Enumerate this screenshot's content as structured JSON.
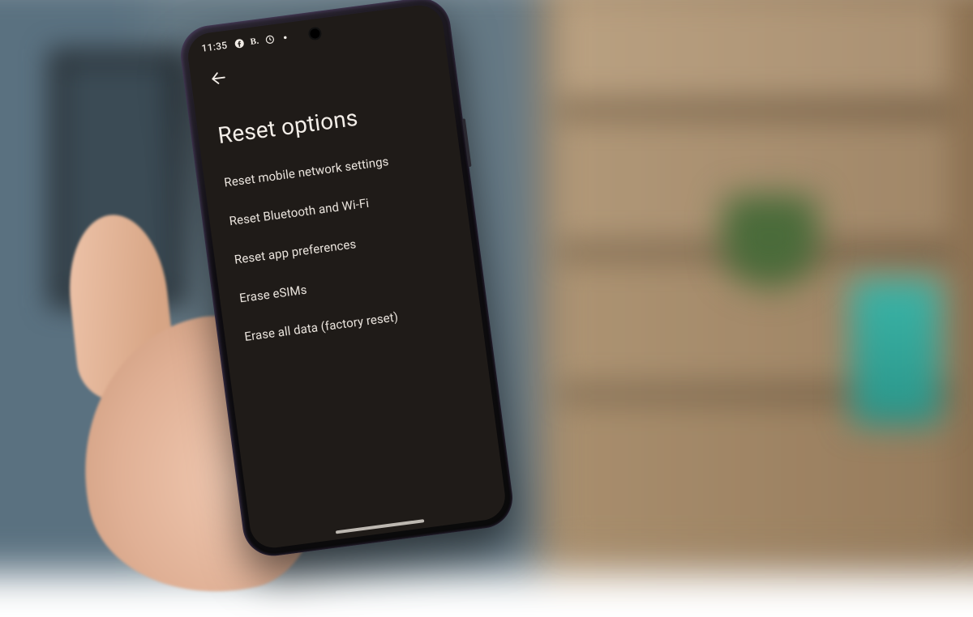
{
  "status_bar": {
    "time": "11:35",
    "icons": [
      "facebook-icon",
      "bold-icon",
      "clock-icon",
      "dot-icon"
    ]
  },
  "header": {
    "back_label": "Back"
  },
  "page": {
    "title": "Reset options"
  },
  "options": [
    {
      "label": "Reset mobile network settings"
    },
    {
      "label": "Reset Bluetooth and Wi-Fi"
    },
    {
      "label": "Reset app preferences"
    },
    {
      "label": "Erase eSIMs"
    },
    {
      "label": "Erase all data (factory reset)"
    }
  ],
  "colors": {
    "screen_bg": "#1f1b18",
    "text": "#eee9e3"
  }
}
